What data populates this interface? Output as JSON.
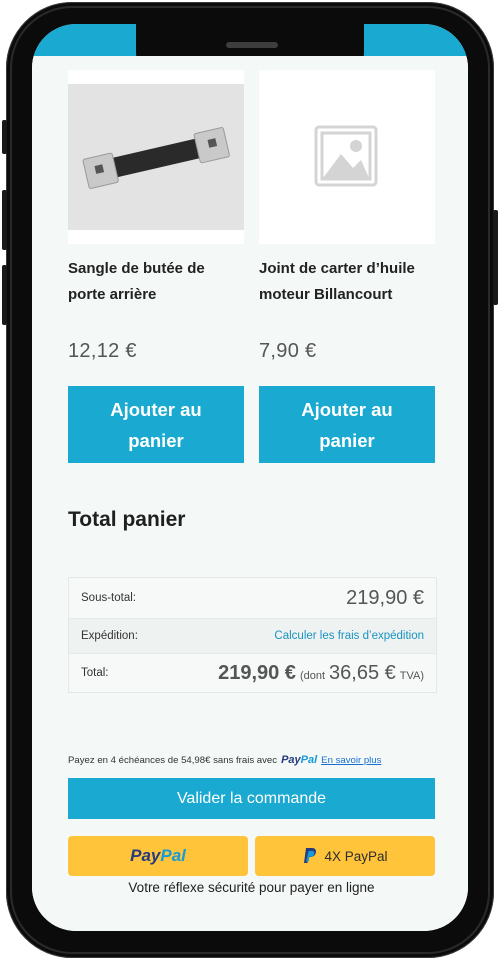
{
  "products": [
    {
      "name": "Sangle de butée de porte arrière",
      "price": "12,12 €",
      "button_label": "Ajouter au panier",
      "image": "strap-photo"
    },
    {
      "name": "Joint de carter d’huile moteur Billancourt",
      "price": "7,90 €",
      "button_label": "Ajouter au panier",
      "image": "image-placeholder-icon"
    }
  ],
  "cart": {
    "title": "Total panier",
    "subtotal_label": "Sous-total:",
    "subtotal_value": "219,90 €",
    "shipping_label": "Expédition:",
    "shipping_link": "Calculer les frais d’expédition",
    "total_label": "Total:",
    "total_value": "219,90 €",
    "tax_prefix": "(dont",
    "tax_value": "36,65 €",
    "tax_suffix": "TVA)"
  },
  "paylater": {
    "text": "Payez en 4 échéances de 54,98€ sans frais avec",
    "brand_pay": "Pay",
    "brand_pal": "Pal",
    "learn_more": "En savoir plus"
  },
  "checkout": {
    "button_label": "Valider la commande"
  },
  "paypal_buttons": {
    "paypal_pay": "Pay",
    "paypal_pal": "Pal",
    "four_x_label": "4X PayPal"
  },
  "security_text": "Votre réflexe sécurité pour payer en ligne",
  "colors": {
    "accent": "#1aa9d0",
    "paypal_yellow": "#ffc439",
    "paypal_dark_blue": "#253b80",
    "paypal_light_blue": "#179bd7",
    "background": "#f4f8f6"
  }
}
